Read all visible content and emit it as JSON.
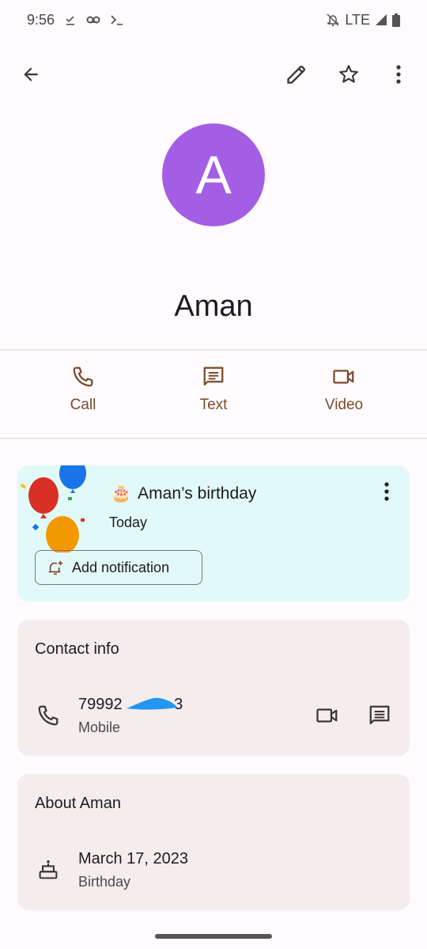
{
  "status_bar": {
    "time": "9:56",
    "left_icons": [
      "download-done-icon",
      "voicemail-icon",
      "terminal-icon"
    ],
    "network": "LTE",
    "right_icons": [
      "notifications-off-icon",
      "signal-icon",
      "battery-icon"
    ]
  },
  "app_bar": {
    "icons": [
      "back-arrow-icon",
      "edit-pencil-icon",
      "star-outline-icon",
      "more-vert-icon"
    ]
  },
  "contact": {
    "avatar_letter": "A",
    "avatar_color": "#a45ee5",
    "name": "Aman"
  },
  "actions": [
    {
      "label": "Call",
      "icon": "phone-icon"
    },
    {
      "label": "Text",
      "icon": "message-icon"
    },
    {
      "label": "Video",
      "icon": "videocam-icon"
    }
  ],
  "accent_color": "#7a4b2a",
  "birthday_card": {
    "emoji": "🎂",
    "title": "Aman’s birthday",
    "subtitle": "Today",
    "button_label": "Add notification",
    "background": "#e2f9f9"
  },
  "contact_info": {
    "title": "Contact info",
    "phone_visible": "79992 ",
    "phone_suffix": "3",
    "phone_label": "Mobile",
    "redacted": true
  },
  "about": {
    "title": "About Aman",
    "date": "March 17, 2023",
    "label": "Birthday"
  }
}
